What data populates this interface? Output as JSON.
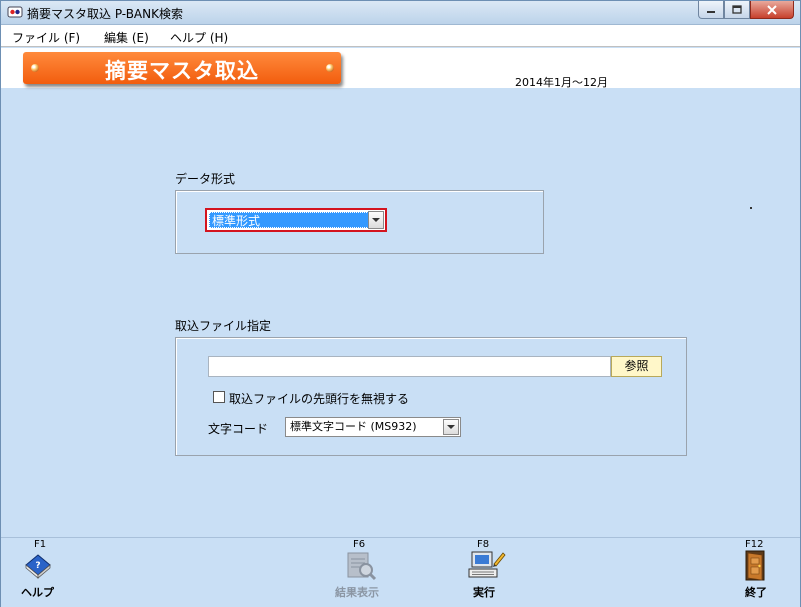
{
  "window": {
    "title": "摘要マスタ取込 P-BANK検索"
  },
  "menu": [
    {
      "label": "ファイル (F)"
    },
    {
      "label": "編集 (E)"
    },
    {
      "label": "ヘルプ (H)"
    }
  ],
  "header": {
    "banner_title": "摘要マスタ取込",
    "period": "2014年1月～12月"
  },
  "data_format": {
    "group_label": "データ形式",
    "selected": "標準形式"
  },
  "import_file": {
    "group_label": "取込ファイル指定",
    "path_value": "",
    "browse_label": "参照",
    "ignore_first_row_label": "取込ファイルの先頭行を無視する",
    "ignore_first_row_checked": false,
    "encoding_label": "文字コード",
    "encoding_selected": "標準文字コード (MS932)"
  },
  "fkeys": [
    {
      "code": "F1",
      "label": "ヘルプ",
      "icon": "help-book-icon",
      "enabled": true
    },
    {
      "code": "F6",
      "label": "結果表示",
      "icon": "result-view-icon",
      "enabled": false
    },
    {
      "code": "F8",
      "label": "実行",
      "icon": "execute-computer-icon",
      "enabled": true
    },
    {
      "code": "F12",
      "label": "終了",
      "icon": "exit-door-icon",
      "enabled": true
    }
  ],
  "colors": {
    "background": "#c9dff5",
    "banner": "#f25d0e",
    "highlight_border": "#d4141e",
    "selection": "#3399ff"
  }
}
